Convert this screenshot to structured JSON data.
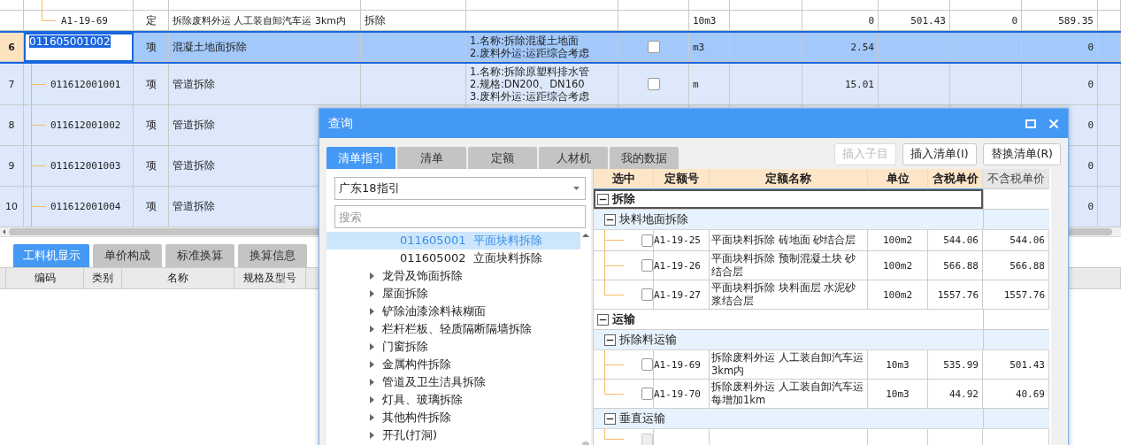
{
  "main_table": {
    "rows": [
      {
        "kind": "quota",
        "selected": false,
        "code": "A1-19-69",
        "type": "定",
        "name": "拆除废料外运 人工装自卸汽车运 3km内",
        "column_5": "拆除",
        "unit": "10m3",
        "quantity": "0",
        "column_11": "501.43",
        "column_12": "0",
        "column_13": "589.35"
      },
      {
        "kind": "bill",
        "selected": true,
        "number": "6",
        "code": "011605001002",
        "type": "项",
        "name": "混凝土地面拆除",
        "spec": [
          "1.名称:拆除混凝土地面",
          "2.废料外运:运距综合考虑"
        ],
        "checked": false,
        "unit": "m3",
        "quantity": "2.54",
        "column_13": "0"
      },
      {
        "kind": "child",
        "selected": false,
        "number": "7",
        "code": "011612001001",
        "type": "项",
        "name": "管道拆除",
        "spec": [
          "1.名称:拆除原塑料排水管",
          "2.规格:DN200、DN160",
          "3.废料外运:运距综合考虑"
        ],
        "checked": false,
        "unit": "m",
        "quantity": "15.01",
        "column_13": "0"
      },
      {
        "kind": "child",
        "selected": false,
        "number": "8",
        "code": "011612001002",
        "type": "项",
        "name": "管道拆除",
        "column_13": "0"
      },
      {
        "kind": "child",
        "selected": false,
        "number": "9",
        "code": "011612001003",
        "type": "项",
        "name": "管道拆除",
        "column_13": "0"
      },
      {
        "kind": "child",
        "selected": false,
        "number": "10",
        "code": "011612001004",
        "type": "项",
        "name": "管道拆除",
        "column_13": "0"
      }
    ]
  },
  "detail_panel": {
    "tabs": [
      {
        "label": "工料机显示",
        "selected": true
      },
      {
        "label": "单价构成",
        "selected": false
      },
      {
        "label": "标准换算",
        "selected": false
      },
      {
        "label": "换算信息",
        "selected": false
      }
    ],
    "columns": [
      "编码",
      "类别",
      "名称",
      "规格及型号"
    ]
  },
  "dialog": {
    "title": "查询",
    "tabs": [
      {
        "label": "清单指引",
        "selected": true
      },
      {
        "label": "清单",
        "selected": false
      },
      {
        "label": "定额",
        "selected": false
      },
      {
        "label": "人材机",
        "selected": false
      },
      {
        "label": "我的数据",
        "selected": false
      }
    ],
    "buttons": [
      {
        "label": "插入子目",
        "disabled": true
      },
      {
        "label": "插入清单(I)",
        "disabled": false
      },
      {
        "label": "替换清单(R)",
        "disabled": false
      }
    ],
    "guide_select": {
      "value": "广东18指引"
    },
    "search": {
      "placeholder": "搜索"
    },
    "guide_tree": [
      {
        "kind": "item",
        "code": "011605001",
        "label": "平面块料拆除",
        "selected": true
      },
      {
        "kind": "item",
        "code": "011605002",
        "label": "立面块料拆除",
        "selected": false
      },
      {
        "kind": "folder",
        "label": "龙骨及饰面拆除",
        "expanded": false,
        "selected": false
      },
      {
        "kind": "folder",
        "label": "屋面拆除",
        "expanded": false,
        "selected": false
      },
      {
        "kind": "folder",
        "label": "铲除油漆涂料裱糊面",
        "expanded": false,
        "selected": false
      },
      {
        "kind": "folder",
        "label": "栏杆栏板、轻质隔断隔墙拆除",
        "expanded": false,
        "selected": false
      },
      {
        "kind": "folder",
        "label": "门窗拆除",
        "expanded": false,
        "selected": false
      },
      {
        "kind": "folder",
        "label": "金属构件拆除",
        "expanded": false,
        "selected": false
      },
      {
        "kind": "folder",
        "label": "管道及卫生洁具拆除",
        "expanded": false,
        "selected": false
      },
      {
        "kind": "folder",
        "label": "灯具、玻璃拆除",
        "expanded": false,
        "selected": false
      },
      {
        "kind": "folder",
        "label": "其他构件拆除",
        "expanded": false,
        "selected": false
      },
      {
        "kind": "folder",
        "label": "开孔(打洞)",
        "expanded": false,
        "selected": false
      }
    ],
    "quota_table": {
      "columns": [
        {
          "label": "选中",
          "kind": "main"
        },
        {
          "label": "定额号",
          "kind": "main"
        },
        {
          "label": "定额名称",
          "kind": "main"
        },
        {
          "label": "单位",
          "kind": "main"
        },
        {
          "label": "含税单价",
          "kind": "main"
        },
        {
          "label": "不含税单价",
          "kind": "plain"
        }
      ],
      "groups": [
        {
          "name": "拆除",
          "expanded": true,
          "selected": true,
          "children": [
            {
              "name": "块料地面拆除",
              "expanded": true,
              "selected": false,
              "items": [
                {
                  "checked": false,
                  "disabled": false,
                  "code": "A1-19-25",
                  "name": "平面块料拆除 砖地面 砂结合层",
                  "unit": "100m2",
                  "tax_price": "544.06",
                  "net_price": "544.06"
                },
                {
                  "checked": false,
                  "disabled": false,
                  "code": "A1-19-26",
                  "name": "平面块料拆除 预制混凝土块 砂结合层",
                  "unit": "100m2",
                  "tax_price": "566.88",
                  "net_price": "566.88"
                },
                {
                  "checked": false,
                  "disabled": false,
                  "code": "A1-19-27",
                  "name": "平面块料拆除 块料面层 水泥砂浆结合层",
                  "unit": "100m2",
                  "tax_price": "1557.76",
                  "net_price": "1557.76"
                }
              ]
            }
          ]
        },
        {
          "name": "运输",
          "expanded": true,
          "selected": false,
          "children": [
            {
              "name": "拆除料运输",
              "expanded": true,
              "selected": false,
              "items": [
                {
                  "checked": false,
                  "disabled": false,
                  "code": "A1-19-69",
                  "name": "拆除废料外运 人工装自卸汽车运3km内",
                  "unit": "10m3",
                  "tax_price": "535.99",
                  "net_price": "501.43"
                },
                {
                  "checked": false,
                  "disabled": false,
                  "code": "A1-19-70",
                  "name": "拆除废料外运 人工装自卸汽车运每增加1km",
                  "unit": "10m3",
                  "tax_price": "44.92",
                  "net_price": "40.69"
                }
              ]
            },
            {
              "name": "垂直运输",
              "expanded": true,
              "selected": false,
              "items": [
                {
                  "checked": false,
                  "disabled": true
                }
              ]
            }
          ]
        }
      ]
    }
  }
}
